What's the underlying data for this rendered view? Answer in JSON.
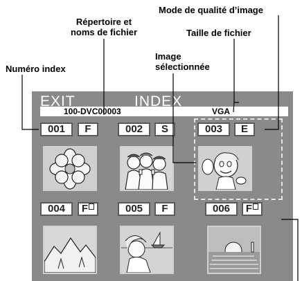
{
  "callouts": {
    "quality_mode": "Mode de qualité d’image",
    "directory_line1": "Répertoire et",
    "directory_line2": "noms de fichier",
    "file_size": "Taille de fichier",
    "selected_line1": "Image",
    "selected_line2": "sélectionnée",
    "index_number": "Numéro index"
  },
  "screen": {
    "exit_label": "EXIT",
    "title": "INDEX",
    "folder_file": "100-DVC00003",
    "quality": "VGA"
  },
  "thumbnails": [
    {
      "number": "001",
      "mode": "F",
      "locked": false,
      "image": "flower"
    },
    {
      "number": "002",
      "mode": "S",
      "locked": false,
      "image": "people-toasting"
    },
    {
      "number": "003",
      "mode": "E",
      "locked": false,
      "image": "boy-eating",
      "selected": true
    },
    {
      "number": "004",
      "mode": "F",
      "locked": true,
      "image": "mountains"
    },
    {
      "number": "005",
      "mode": "F",
      "locked": false,
      "image": "woman-by-sea"
    },
    {
      "number": "006",
      "mode": "F",
      "locked": true,
      "image": "sunset"
    }
  ],
  "colors": {
    "screen_bg": "#8a8a8a",
    "text_white": "#ffffff",
    "box_border": "#5a5a5a"
  }
}
